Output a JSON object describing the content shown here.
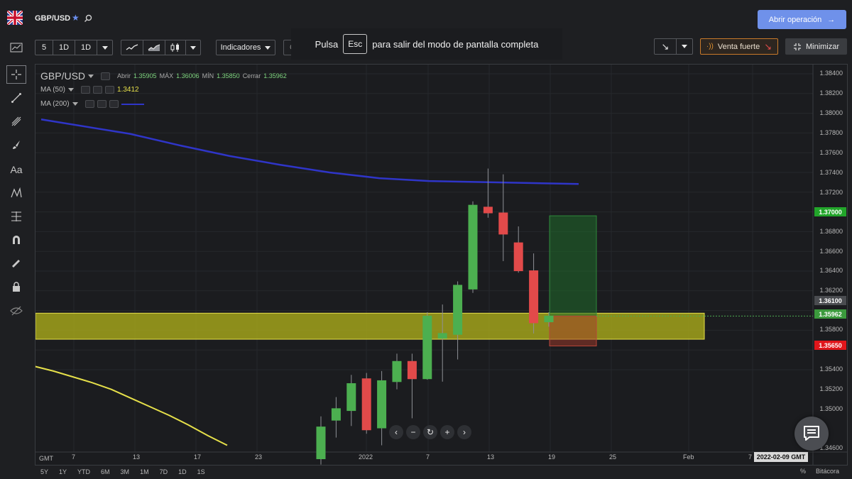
{
  "header": {
    "symbol": "GBP/USD",
    "open_operation_label": "Abrir operación"
  },
  "toolbar": {
    "interval_buttons": [
      "5",
      "1D",
      "1D"
    ],
    "indicators_label": "Indicadores",
    "compare_label": "Comparar",
    "fullscreen_notice": {
      "before": "Pulsa",
      "key": "Esc",
      "after": "para salir del modo de pantalla completa"
    },
    "signal_label": "Venta fuerte",
    "minimize_label": "Minimizar"
  },
  "legend": {
    "symbol": "GBP/USD",
    "open_label": "Abrir",
    "open": "1.35905",
    "high_label": "MÁX",
    "high": "1.36006",
    "low_label": "MÍN",
    "low": "1.35850",
    "close_label": "Cerrar",
    "close": "1.35962",
    "ma50_label": "MA (50)",
    "ma50_value": "1.3412",
    "ma200_label": "MA (200)"
  },
  "price_axis": [
    "1.38400",
    "1.38200",
    "1.38000",
    "1.37800",
    "1.37600",
    "1.37400",
    "1.37200",
    "1.36800",
    "1.36600",
    "1.36400",
    "1.36200",
    "1.35800",
    "1.35400",
    "1.35200",
    "1.35000",
    "1.34600"
  ],
  "price_tags": {
    "target": "1.37000",
    "level": "1.36100",
    "last": "1.35962",
    "stop": "1.35650"
  },
  "date_axis": {
    "gmt": "GMT",
    "labels": [
      "7",
      "13",
      "17",
      "23",
      "2022",
      "7",
      "13",
      "19",
      "25",
      "Feb",
      "7"
    ],
    "cursor_date": "2022-02-09 GMT"
  },
  "ranges": [
    "5Y",
    "1Y",
    "YTD",
    "6M",
    "3M",
    "1M",
    "7D",
    "1D",
    "1S"
  ],
  "footer": {
    "percent": "%",
    "log": "Bitácora"
  },
  "colors": {
    "up": "#4caf50",
    "down": "#e24a4a",
    "ma50": "#e6e04a",
    "ma200": "#2f35c8",
    "zone": "#b8b81e",
    "accent": "#6f91ea",
    "target_tag": "#22a52a",
    "stop_tag": "#e0161b"
  },
  "chart_data": {
    "type": "candlestick",
    "y_range": [
      1.3455,
      1.3848
    ],
    "candles": [
      {
        "o": 1.3448,
        "h": 1.3492,
        "l": 1.3442,
        "c": 1.3481
      },
      {
        "o": 1.3488,
        "h": 1.3512,
        "l": 1.347,
        "c": 1.35
      },
      {
        "o": 1.3498,
        "h": 1.3535,
        "l": 1.3482,
        "c": 1.3526
      },
      {
        "o": 1.3531,
        "h": 1.3537,
        "l": 1.3474,
        "c": 1.3478
      },
      {
        "o": 1.348,
        "h": 1.3539,
        "l": 1.3462,
        "c": 1.3529
      },
      {
        "o": 1.3528,
        "h": 1.3557,
        "l": 1.352,
        "c": 1.3549
      },
      {
        "o": 1.3549,
        "h": 1.3557,
        "l": 1.349,
        "c": 1.3531
      },
      {
        "o": 1.3531,
        "h": 1.36,
        "l": 1.353,
        "c": 1.3596
      },
      {
        "o": 1.3573,
        "h": 1.3608,
        "l": 1.3528,
        "c": 1.3578
      },
      {
        "o": 1.3577,
        "h": 1.3632,
        "l": 1.3551,
        "c": 1.3628
      },
      {
        "o": 1.3624,
        "h": 1.3715,
        "l": 1.362,
        "c": 1.3711
      },
      {
        "o": 1.3709,
        "h": 1.3749,
        "l": 1.3698,
        "c": 1.3703
      },
      {
        "o": 1.3703,
        "h": 1.3743,
        "l": 1.3653,
        "c": 1.3681
      },
      {
        "o": 1.3672,
        "h": 1.3689,
        "l": 1.3641,
        "c": 1.3643
      },
      {
        "o": 1.3643,
        "h": 1.3661,
        "l": 1.3578,
        "c": 1.3589
      },
      {
        "o": 1.359,
        "h": 1.36,
        "l": 1.3585,
        "c": 1.3596
      }
    ],
    "ma50": [
      [
        -15,
        1.3544
      ],
      [
        -14,
        1.3539
      ],
      [
        -13,
        1.3533
      ],
      [
        -12,
        1.3527
      ],
      [
        -11,
        1.352
      ],
      [
        -10,
        1.3511
      ],
      [
        -9,
        1.3502
      ],
      [
        -8,
        1.3493
      ],
      [
        -7,
        1.3483
      ],
      [
        -6,
        1.3472
      ],
      [
        -5,
        1.3462
      ]
    ],
    "ma200": [
      [
        -15,
        1.3797
      ],
      [
        -12,
        1.3785
      ],
      [
        -9,
        1.3773
      ],
      [
        -6,
        1.3762
      ],
      [
        -3,
        1.3753
      ],
      [
        0,
        1.3745
      ],
      [
        3,
        1.3739
      ],
      [
        6,
        1.3736
      ],
      [
        9,
        1.3735
      ],
      [
        12,
        1.3734
      ],
      [
        15,
        1.3733
      ]
    ],
    "zone": {
      "top": 1.3599,
      "bottom": 1.3572
    },
    "position": {
      "entry": 1.3596,
      "target": 1.37,
      "stop": 1.3565
    }
  }
}
